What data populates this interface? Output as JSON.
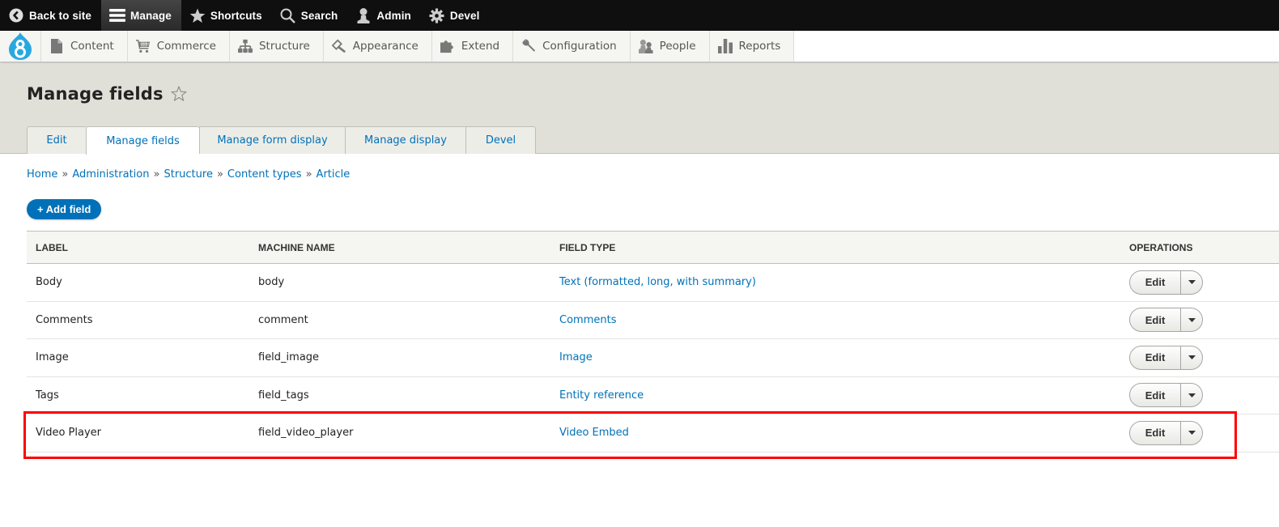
{
  "toolbar": {
    "items": [
      {
        "label": "Back to site",
        "icon": "chevron-left-circle-icon"
      },
      {
        "label": "Manage",
        "icon": "hamburger-menu-icon",
        "active": true
      },
      {
        "label": "Shortcuts",
        "icon": "star-icon"
      },
      {
        "label": "Search",
        "icon": "search-icon"
      },
      {
        "label": "Admin",
        "icon": "user-icon"
      },
      {
        "label": "Devel",
        "icon": "gear-icon"
      }
    ]
  },
  "tray": {
    "logo": "drupal-8-logo",
    "items": [
      {
        "label": "Content",
        "icon": "file-icon"
      },
      {
        "label": "Commerce",
        "icon": "shopping-cart-icon"
      },
      {
        "label": "Structure",
        "icon": "sitemap-icon"
      },
      {
        "label": "Appearance",
        "icon": "paintbrush-icon"
      },
      {
        "label": "Extend",
        "icon": "puzzle-icon"
      },
      {
        "label": "Configuration",
        "icon": "wrench-icon"
      },
      {
        "label": "People",
        "icon": "people-icon"
      },
      {
        "label": "Reports",
        "icon": "bar-chart-icon"
      }
    ]
  },
  "header": {
    "title": "Manage fields",
    "tabs": [
      {
        "label": "Edit",
        "active": false
      },
      {
        "label": "Manage fields",
        "active": true
      },
      {
        "label": "Manage form display",
        "active": false
      },
      {
        "label": "Manage display",
        "active": false
      },
      {
        "label": "Devel",
        "active": false
      }
    ]
  },
  "breadcrumb": {
    "separator": "»",
    "items": [
      "Home",
      "Administration",
      "Structure",
      "Content types",
      "Article"
    ]
  },
  "actions": {
    "add_field": "+ Add field"
  },
  "table": {
    "columns": [
      "Label",
      "Machine name",
      "Field type",
      "Operations"
    ],
    "rows": [
      {
        "label": "Body",
        "machine_name": "body",
        "field_type": "Text (formatted, long, with summary)",
        "operation": "Edit"
      },
      {
        "label": "Comments",
        "machine_name": "comment",
        "field_type": "Comments",
        "operation": "Edit"
      },
      {
        "label": "Image",
        "machine_name": "field_image",
        "field_type": "Image",
        "operation": "Edit"
      },
      {
        "label": "Tags",
        "machine_name": "field_tags",
        "field_type": "Entity reference",
        "operation": "Edit"
      },
      {
        "label": "Video Player",
        "machine_name": "field_video_player",
        "field_type": "Video Embed",
        "operation": "Edit",
        "highlighted": true
      }
    ]
  },
  "colors": {
    "link": "#0071b8",
    "toolbar_bg": "#0f0f0f",
    "header_bg": "#e0e0d8",
    "highlight": "#ff0000",
    "drupal_blue": "#29a8e0"
  }
}
